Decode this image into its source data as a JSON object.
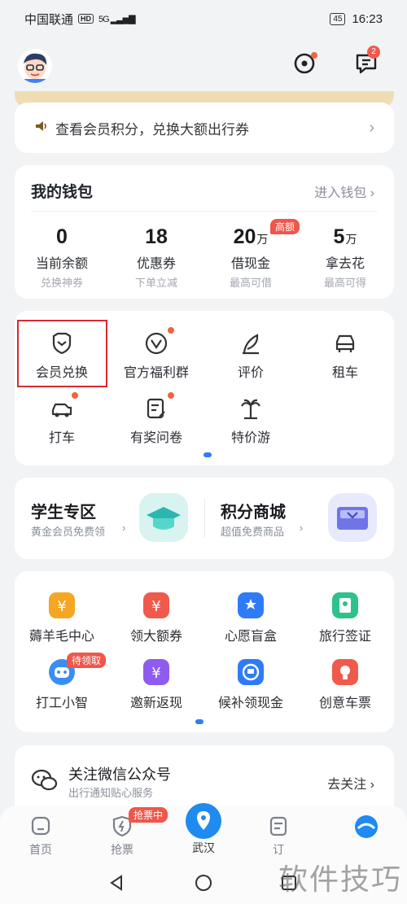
{
  "status": {
    "carrier": "中国联通",
    "hd": "HD",
    "signal": "5G",
    "battery": "45",
    "time": "16:23"
  },
  "header": {
    "message_badge": "2"
  },
  "notice": {
    "text": "查看会员积分，兑换大额出行券"
  },
  "wallet": {
    "title": "我的钱包",
    "enter": "进入钱包",
    "high_tag": "高额",
    "items": [
      {
        "value": "0",
        "unit": "",
        "label": "当前余额",
        "sub": "兑换神券"
      },
      {
        "value": "18",
        "unit": "",
        "label": "优惠券",
        "sub": "下单立减"
      },
      {
        "value": "20",
        "unit": "万",
        "label": "借现金",
        "sub": "最高可借"
      },
      {
        "value": "5",
        "unit": "万",
        "label": "拿去花",
        "sub": "最高可得"
      }
    ]
  },
  "services": {
    "items": [
      {
        "label": "会员兑换",
        "icon": "shield-check-icon"
      },
      {
        "label": "官方福利群",
        "icon": "chat-v-icon"
      },
      {
        "label": "评价",
        "icon": "feather-icon"
      },
      {
        "label": "租车",
        "icon": "car-icon"
      },
      {
        "label": "打车",
        "icon": "taxi-icon"
      },
      {
        "label": "有奖问卷",
        "icon": "survey-icon"
      },
      {
        "label": "特价游",
        "icon": "palm-tree-icon"
      }
    ]
  },
  "promo": {
    "left": {
      "title": "学生专区",
      "subtitle": "黄金会员免费领"
    },
    "right": {
      "title": "积分商城",
      "subtitle": "超值免费商品"
    }
  },
  "benefits": {
    "pending_tag": "待领取",
    "items": [
      {
        "label": "薅羊毛中心",
        "color": "#f5a623"
      },
      {
        "label": "领大额券",
        "color": "#f05a4d"
      },
      {
        "label": "心愿盲盒",
        "color": "#2f7bf5"
      },
      {
        "label": "旅行签证",
        "color": "#2ec28b"
      },
      {
        "label": "打工小智",
        "color": "#3a8df5"
      },
      {
        "label": "邀新返现",
        "color": "#8e5cf0"
      },
      {
        "label": "候补领现金",
        "color": "#2f7bf5"
      },
      {
        "label": "创意车票",
        "color": "#f05a4d"
      }
    ]
  },
  "follow": {
    "title": "关注微信公众号",
    "subtitle": "出行通知贴心服务",
    "action": "去关注"
  },
  "tabbar": {
    "home": "首页",
    "ticket": "抢票",
    "ticket_tag": "抢票中",
    "city": "武汉",
    "order": "订"
  },
  "watermark": "软件技巧",
  "colors": {
    "accent": "#2d7df6",
    "highlight_border": "#d8292f",
    "badge": "#f0564a"
  }
}
